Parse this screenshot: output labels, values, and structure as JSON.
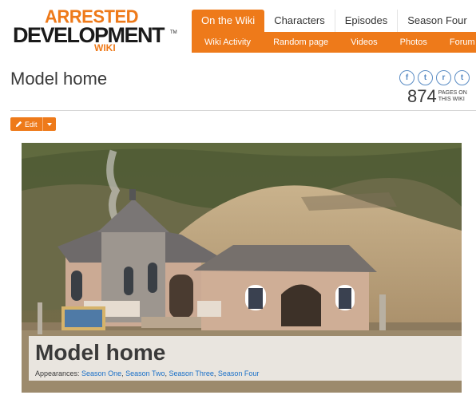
{
  "logo": {
    "line1": "ARRESTED",
    "line2": "DEVELOPMENT",
    "line3": "WIKI",
    "trademark": "TM"
  },
  "nav": {
    "tabs": [
      "On the Wiki",
      "Characters",
      "Episodes",
      "Season Four"
    ],
    "sub_items": [
      "Wiki Activity",
      "Random page",
      "Videos",
      "Photos",
      "Forum"
    ]
  },
  "page": {
    "title": "Model home",
    "count": "874",
    "count_label_1": "PAGES ON",
    "count_label_2": "THIS WIKI"
  },
  "social": {
    "facebook": "f",
    "twitter": "t",
    "reddit": "r",
    "tumblr": "t"
  },
  "toolbar": {
    "edit_label": "Edit"
  },
  "hero": {
    "title": "Model home",
    "appearances_label": "Appearances:",
    "appearances": [
      "Season One",
      "Season Two",
      "Season Three",
      "Season Four"
    ],
    "separator": ", "
  },
  "colors": {
    "accent": "#ee7a1a",
    "link": "#1a70c8",
    "social": "#5a8cc4"
  }
}
